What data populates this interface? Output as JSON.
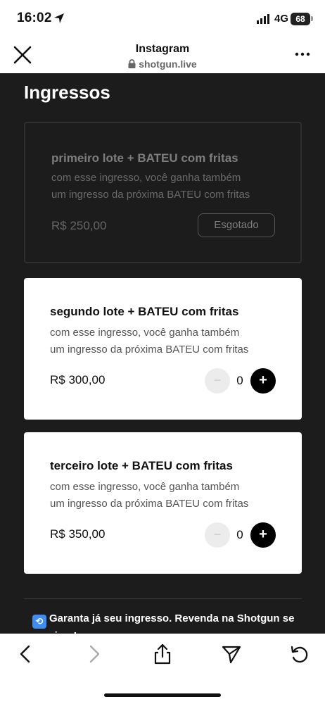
{
  "status_bar": {
    "time": "16:02",
    "network": "4G",
    "battery": "68"
  },
  "browser": {
    "title": "Instagram",
    "url": "shotgun.live"
  },
  "section_title": "Ingressos",
  "tickets": [
    {
      "name": "primeiro lote + BATEU com fritas",
      "desc_line1": "com esse ingresso, você ganha também",
      "desc_line2": "um ingresso da próxima BATEU com fritas",
      "price": "R$ 250,00",
      "status_label": "Esgotado"
    },
    {
      "name": "segundo lote + BATEU com fritas",
      "desc_line1": "com esse ingresso, você ganha também",
      "desc_line2": "um ingresso da próxima BATEU com fritas",
      "price": "R$ 300,00",
      "quantity": "0",
      "minus_label": "−",
      "plus_label": "+"
    },
    {
      "name": "terceiro lote + BATEU com fritas",
      "desc_line1": "com esse ingresso, você ganha também",
      "desc_line2": "um ingresso da próxima BATEU com fritas",
      "price": "R$ 350,00",
      "quantity": "0",
      "minus_label": "−",
      "plus_label": "+"
    }
  ],
  "resale": {
    "icon_glyph": "⟲",
    "text": "Garanta já seu ingresso. Revenda na Shotgun se precisar!"
  },
  "colors": {
    "content_background": "#1c1c1c",
    "card_background": "#ffffff",
    "resale_icon": "#3d8ef0"
  },
  "icons": {
    "close": "close-icon",
    "more": "more-icon",
    "lock": "lock-icon",
    "back": "back-arrow-icon",
    "forward": "forward-arrow-icon",
    "share": "share-icon",
    "send": "send-icon",
    "reload": "reload-icon"
  }
}
